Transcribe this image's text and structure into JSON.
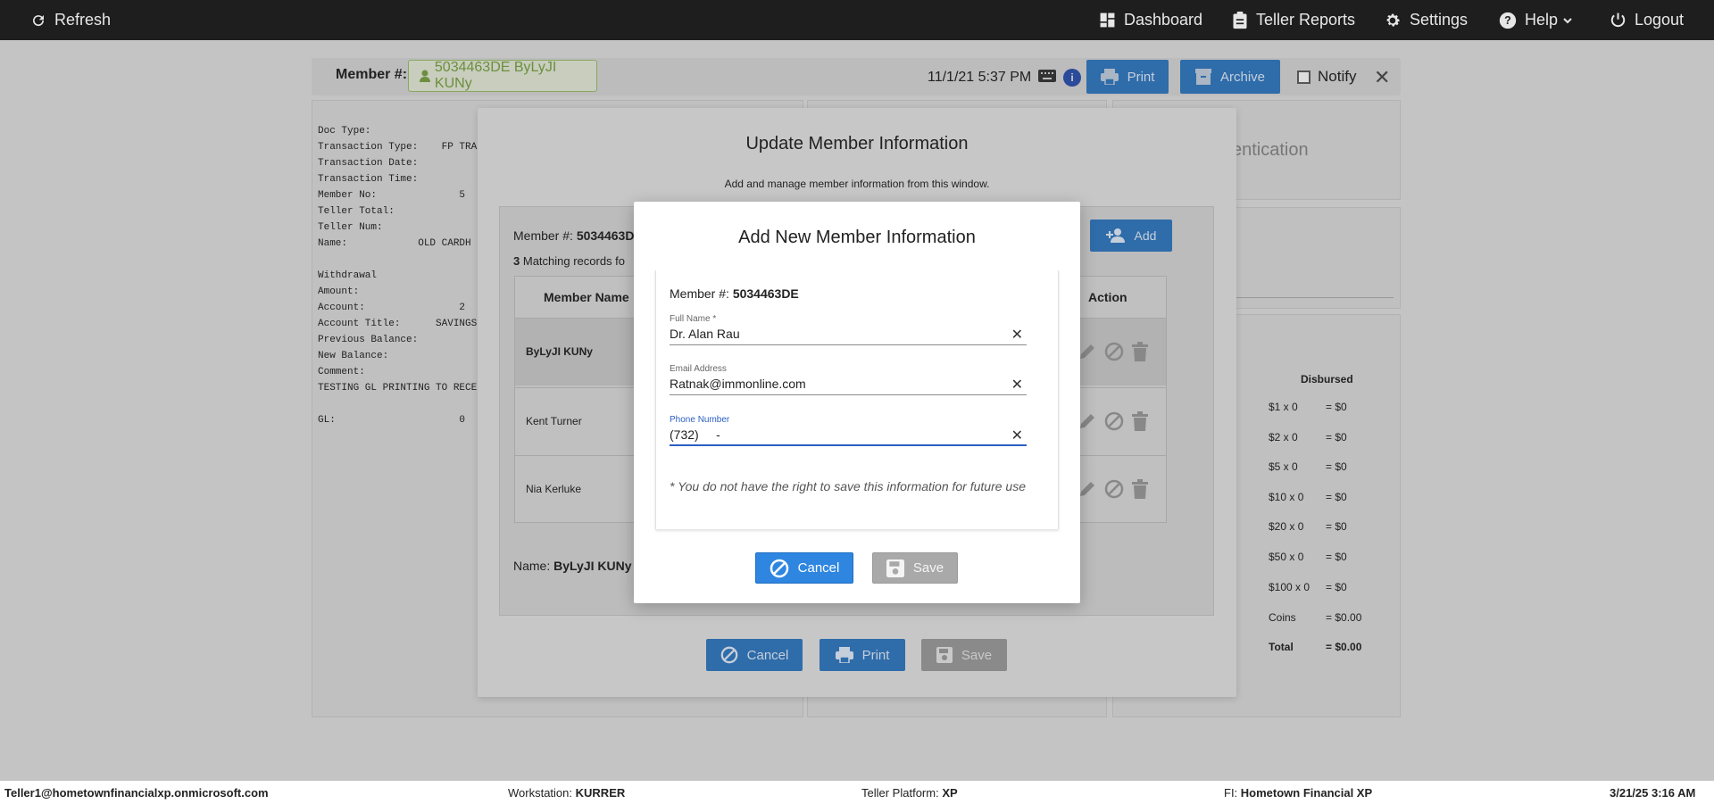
{
  "topbar": {
    "refresh": "Refresh",
    "dashboard": "Dashboard",
    "teller_reports": "Teller Reports",
    "settings": "Settings",
    "help": "Help",
    "logout": "Logout"
  },
  "member_bar": {
    "label": "Member #:",
    "badge": "5034463DE ByLyJI KUNy",
    "datetime": "11/1/21 5:37 PM",
    "info": "i",
    "print": "Print",
    "archive": "Archive",
    "notify": "Notify"
  },
  "receipt": {
    "lines": [
      "Doc Type:",
      "Transaction Type:    FP TRA",
      "Transaction Date:",
      "Transaction Time:",
      "Member No:              5",
      "Teller Total:",
      "Teller Num:",
      "Name:            OLD CARDH",
      "",
      "Withdrawal",
      "Amount:",
      "Account:                2",
      "Account Title:      SAVINGS",
      "Previous Balance:",
      "New Balance:",
      "Comment:",
      "TESTING GL PRINTING TO RECE",
      "",
      "GL:                     0"
    ]
  },
  "auth_panel": {
    "title": "entication"
  },
  "disbursed": {
    "header": "Disbursed",
    "rows": [
      {
        "label": "$1 x 0",
        "value": "= $0"
      },
      {
        "label": "$2 x 0",
        "value": "= $0"
      },
      {
        "label": "$5 x 0",
        "value": "= $0"
      },
      {
        "label": "$10 x 0",
        "value": "= $0"
      },
      {
        "label": "$20 x 0",
        "value": "= $0"
      },
      {
        "label": "$50 x 0",
        "value": "= $0"
      },
      {
        "label": "$100 x 0",
        "value": "= $0"
      },
      {
        "label": "Coins",
        "value": "= $0.00"
      },
      {
        "label": "Total",
        "value": "= $0.00"
      }
    ]
  },
  "update_modal": {
    "title": "Update Member Information",
    "subtitle": "Add and manage member information from this window.",
    "member_label": "Member #:",
    "member_value": "5034463D",
    "matching_count": "3",
    "matching_text": "Matching records fo",
    "add": "Add",
    "col_name": "Member Name",
    "col_action": "Action",
    "rows": [
      "ByLyJI KUNy",
      "Kent Turner",
      "Nia Kerluke"
    ],
    "name_label": "Name:",
    "name_value": "ByLyJI KUNy",
    "cancel": "Cancel",
    "print": "Print",
    "save": "Save"
  },
  "add_modal": {
    "title": "Add New Member Information",
    "member_label": "Member #:",
    "member_value": "5034463DE",
    "full_name_label": "Full Name *",
    "full_name_value": "Dr. Alan Rau",
    "email_label": "Email Address",
    "email_value": "Ratnak@immonline.com",
    "phone_label": "Phone Number",
    "phone_value": "(732)     -",
    "note": "* You do not have the right to save this information for future use",
    "cancel": "Cancel",
    "save": "Save"
  },
  "statusbar": {
    "user": "Teller1@hometownfinancialxp.onmicrosoft.com",
    "workstation_label": "Workstation:",
    "workstation_value": "KURRER",
    "platform_label": "Teller Platform:",
    "platform_value": "XP",
    "fi_label": "FI:",
    "fi_value": "Hometown Financial XP",
    "datetime": "3/21/25 3:16 AM"
  },
  "colors": {
    "topbar": "#1e1e1e",
    "primary": "#2f86e0",
    "disabled": "#a9a9a9",
    "focus": "#2b5fc4"
  }
}
